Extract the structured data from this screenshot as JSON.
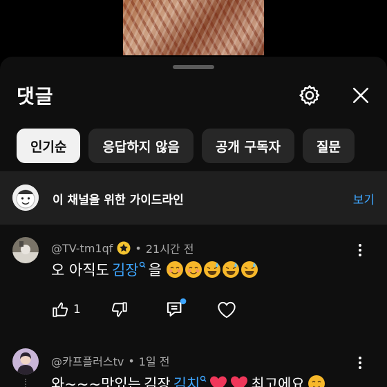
{
  "sheet": {
    "title": "댓글"
  },
  "filters": [
    {
      "label": "인기순",
      "active": true
    },
    {
      "label": "응답하지 않음",
      "active": false
    },
    {
      "label": "공개 구독자",
      "active": false
    },
    {
      "label": "질문",
      "active": false
    }
  ],
  "guideline": {
    "text": "이 채널을 위한 가이드라인",
    "link": "보기"
  },
  "comments": [
    {
      "author": "@TV-tm1qf",
      "separator": "•",
      "time": "21시간 전",
      "text_before": "오  아직도",
      "link_text": "김장",
      "text_after": "을",
      "like_count": "1"
    },
    {
      "author": "@카프플러스tv",
      "separator": "•",
      "time": "1일 전",
      "text_before": "와~~~맛있는",
      "link_text": "김장",
      "link_text_2": "김치",
      "text_after": "최고에요"
    }
  ],
  "icons": {
    "settings": "gear-icon",
    "close": "close-icon",
    "like": "thumbs-up-icon",
    "dislike": "thumbs-down-icon",
    "reply": "reply-icon",
    "heart": "heart-icon",
    "more": "more-vert-icon",
    "search_link": "search-link-icon"
  },
  "colors": {
    "link": "#3ea6ff",
    "chip_active": "#f1f1f1",
    "sheet_bg": "#0f0f0f"
  }
}
